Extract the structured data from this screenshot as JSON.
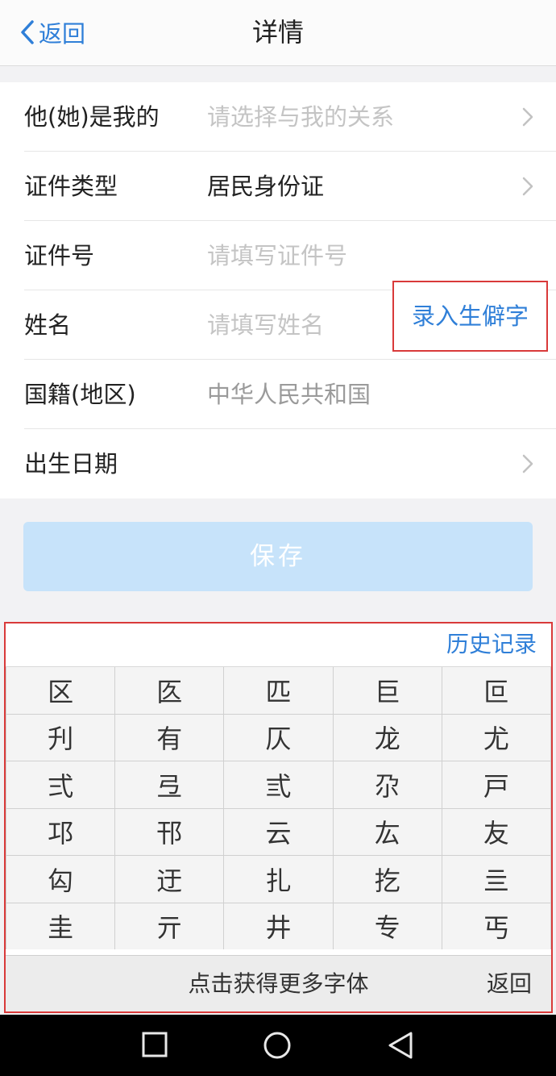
{
  "nav": {
    "back_label": "返回",
    "title": "详情"
  },
  "form": {
    "relation": {
      "label": "他(她)是我的",
      "placeholder": "请选择与我的关系"
    },
    "id_type": {
      "label": "证件类型",
      "value": "居民身份证"
    },
    "id_number": {
      "label": "证件号",
      "placeholder": "请填写证件号"
    },
    "name": {
      "label": "姓名",
      "placeholder": "请填写姓名",
      "rare_char_button": "录入生僻字"
    },
    "nationality": {
      "label": "国籍(地区)",
      "value": "中华人民共和国"
    },
    "birth_date": {
      "label": "出生日期",
      "value": ""
    }
  },
  "save_button": "保存",
  "keyboard": {
    "history_label": "历史记录",
    "chars": [
      [
        "区",
        "匛",
        "匹",
        "巨",
        "叵"
      ],
      [
        "刋",
        "有",
        "仄",
        "龙",
        "尤"
      ],
      [
        "弍",
        "弖",
        "弎",
        "尕",
        "戸"
      ],
      [
        "邛",
        "邗",
        "云",
        "厷",
        "友"
      ],
      [
        "匃",
        "迂",
        "扎",
        "扢",
        "亖"
      ],
      [
        "圭",
        "亓",
        "井",
        "专",
        "丐"
      ]
    ],
    "more_fonts_label": "点击获得更多字体",
    "back_label": "返回"
  },
  "colors": {
    "accent": "#2f7fd8",
    "highlight_border": "#d93a3a",
    "save_button_bg": "#c7e3fa"
  },
  "icons": {
    "back": "chevron-left-icon",
    "row_arrow": "chevron-right-icon",
    "system_recent": "square-icon",
    "system_home": "circle-icon",
    "system_back": "triangle-back-icon"
  }
}
